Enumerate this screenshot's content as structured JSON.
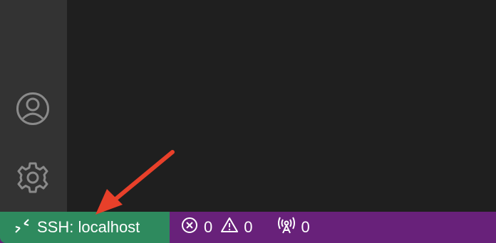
{
  "activity_bar": {
    "icons": [
      "account-icon",
      "gear-icon"
    ]
  },
  "status_bar": {
    "remote": {
      "icon": "remote-icon",
      "label": "SSH: localhost"
    },
    "problems": {
      "errors": "0",
      "warnings": "0"
    },
    "ports": {
      "icon": "broadcast-icon",
      "count": "0"
    }
  },
  "colors": {
    "activity_bar": "#333333",
    "editor_bg": "#1f1f1f",
    "status_bar": "#68217a",
    "remote_indicator": "#2e8a5e",
    "annotation_arrow": "#e8402a"
  }
}
